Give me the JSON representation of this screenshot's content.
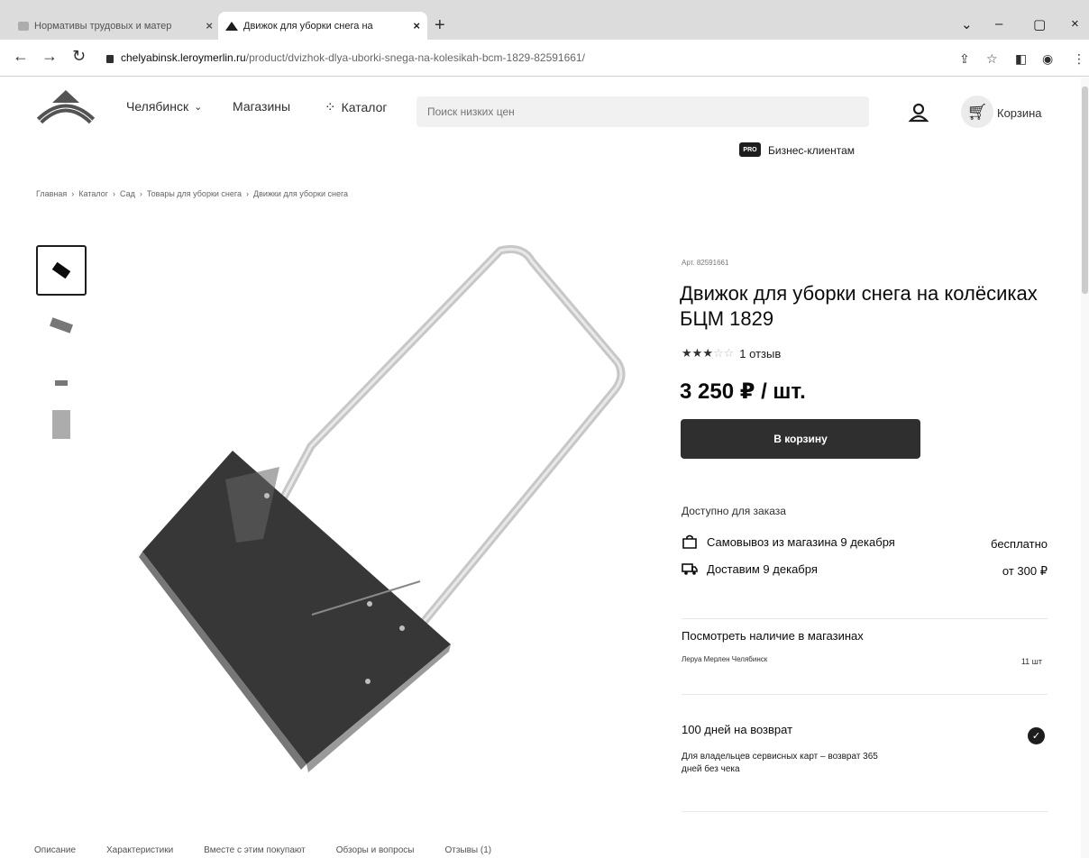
{
  "browser": {
    "tabs": [
      {
        "title": "Нормативы трудовых и матер"
      },
      {
        "title": "Движок для уборки снега на"
      }
    ],
    "url_host": "chelyabinsk.leroymerlin.ru",
    "url_path": "/product/dvizhok-dlya-uborki-snega-na-kolesikah-bcm-1829-82591661/"
  },
  "header": {
    "city": "Челябинск",
    "stores": "Магазины",
    "catalog": "Каталог",
    "search_placeholder": "Поиск низких цен",
    "cart": "Корзина",
    "pro_badge": "PRO",
    "business": "Бизнес-клиентам"
  },
  "breadcrumbs": [
    "Главная",
    "Каталог",
    "Сад",
    "Товары для уборки снега",
    "Движки для уборки снега"
  ],
  "product": {
    "sku": "Арт. 82591661",
    "title": "Движок для уборки снега на колёсиках БЦМ 1829",
    "rating": 3,
    "rating_max": 5,
    "reviews": "1 отзыв",
    "price": "3 250 ₽ / шт.",
    "add_to_cart": "В корзину"
  },
  "availability": {
    "label": "Доступно для заказа",
    "pickup": "Самовывоз из магазина 9 декабря",
    "pickup_price": "бесплатно",
    "delivery": "Доставим 9 декабря",
    "delivery_price": "от 300 ₽"
  },
  "stock": {
    "title": "Посмотреть наличие в магазинах",
    "store": "Леруа Мерлен Челябинск",
    "qty": "11 шт"
  },
  "returns": {
    "title": "100 дней на возврат",
    "desc": "Для владельцев сервисных карт – возврат 365 дней без чека"
  },
  "bottom_tabs": [
    "Описание",
    "Характеристики",
    "Вместе с этим покупают",
    "Обзоры и вопросы",
    "Отзывы (1)"
  ],
  "colors": {
    "accent": "#333333",
    "brand_green": "#66a82d"
  }
}
